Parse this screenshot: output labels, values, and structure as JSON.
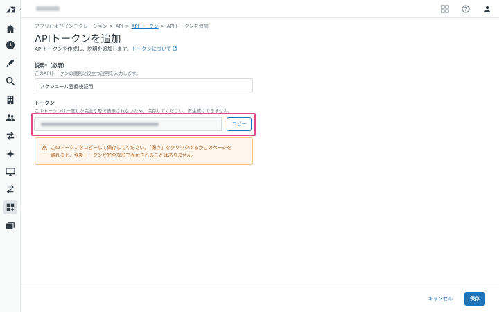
{
  "header": {
    "account_name_blurred": "account",
    "icons": [
      "apps-grid-icon",
      "help-icon",
      "user-icon"
    ]
  },
  "sidebar": {
    "items": [
      {
        "name": "zendesk-logo-icon"
      },
      {
        "name": "home-icon"
      },
      {
        "name": "clock-icon"
      },
      {
        "name": "rocket-icon"
      },
      {
        "name": "search-icon"
      },
      {
        "name": "building-icon"
      },
      {
        "name": "people-icon"
      },
      {
        "name": "transfer-icon"
      },
      {
        "name": "sparkle-icon"
      },
      {
        "name": "monitor-icon"
      },
      {
        "name": "routing-icon"
      },
      {
        "name": "apps-icon"
      },
      {
        "name": "workspace-icon"
      }
    ]
  },
  "breadcrumb": {
    "item1": "アプリおよびインテグレーション",
    "item2": "API",
    "item3": "APIトークン",
    "item4": "APIトークンを追加",
    "separator": ">"
  },
  "page": {
    "title": "APIトークンを追加",
    "subtitle": "APIトークンを作成し、説明を追加します。",
    "subtitle_link": "トークンについて",
    "external_link_icon": "external-link-icon"
  },
  "description_field": {
    "label": "説明*（必須）",
    "hint": "このAPIトークンの識別に役立つ説明を入力します。",
    "value": "スケジュール登録検証用"
  },
  "token_field": {
    "label": "トークン",
    "hint": "このトークンは一度しか完全な形で表示されないため、保存してください。再生成はできません。",
    "value_blurred": "token",
    "copy_label": "コピー"
  },
  "warning": {
    "line1": "このトークンをコピーして保存してください。「保存」をクリックするかこのページを",
    "line2": "離れると、今後トークンが完全な形で表示されることはありません。"
  },
  "footer": {
    "cancel_label": "キャンセル",
    "save_label": "保存"
  },
  "colors": {
    "accent": "#1f73b7",
    "highlight": "#e0468e",
    "warning_bg": "#fff7ed",
    "warning_text": "#ad5918"
  }
}
